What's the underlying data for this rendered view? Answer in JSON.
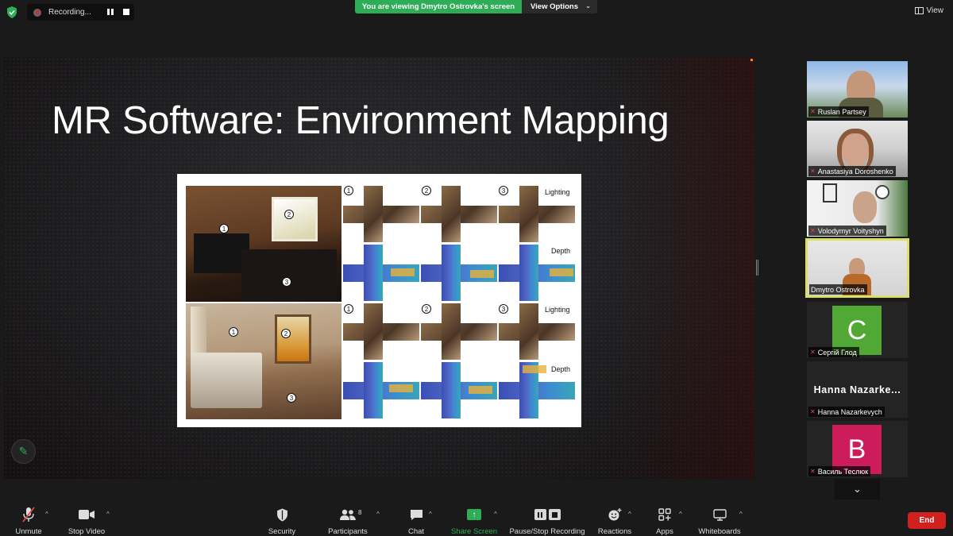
{
  "topbar": {
    "recording_label": "Recording...",
    "viewing_banner": "You are viewing Dmytro Ostrovka's screen",
    "view_options_label": "View Options",
    "view_label": "View"
  },
  "slide": {
    "title": "MR Software: Environment Mapping",
    "figure": {
      "row_labels_lighting": "Lighting",
      "row_labels_depth": "Depth",
      "markers": [
        "1",
        "2",
        "3"
      ]
    }
  },
  "participants": [
    {
      "name": "Ruslan Partsey",
      "muted": true,
      "video": true
    },
    {
      "name": "Anastasiya Doroshenko",
      "muted": true,
      "video": true
    },
    {
      "name": "Volodymyr Voityshyn",
      "muted": true,
      "video": true
    },
    {
      "name": "Dmytro Ostrovka",
      "muted": false,
      "video": true,
      "active": true
    },
    {
      "name": "Сергій Глод",
      "muted": true,
      "initial": "C",
      "avatar_color": "#52a834"
    },
    {
      "name": "Hanna Nazarkevych",
      "muted": true,
      "display": "Hanna  Nazarke..."
    },
    {
      "name": "Василь Теслюк",
      "muted": true,
      "initial": "B",
      "avatar_color": "#cc1c5a"
    }
  ],
  "toolbar": {
    "unmute": "Unmute",
    "stop_video": "Stop Video",
    "security": "Security",
    "participants": "Participants",
    "participants_count": "8",
    "chat": "Chat",
    "share_screen": "Share Screen",
    "pause_stop_recording": "Pause/Stop Recording",
    "reactions": "Reactions",
    "apps": "Apps",
    "whiteboards": "Whiteboards",
    "end": "End"
  },
  "colors": {
    "accent_green": "#2ead56",
    "end_red": "#d0211f",
    "active_speaker": "#d8e06a"
  }
}
